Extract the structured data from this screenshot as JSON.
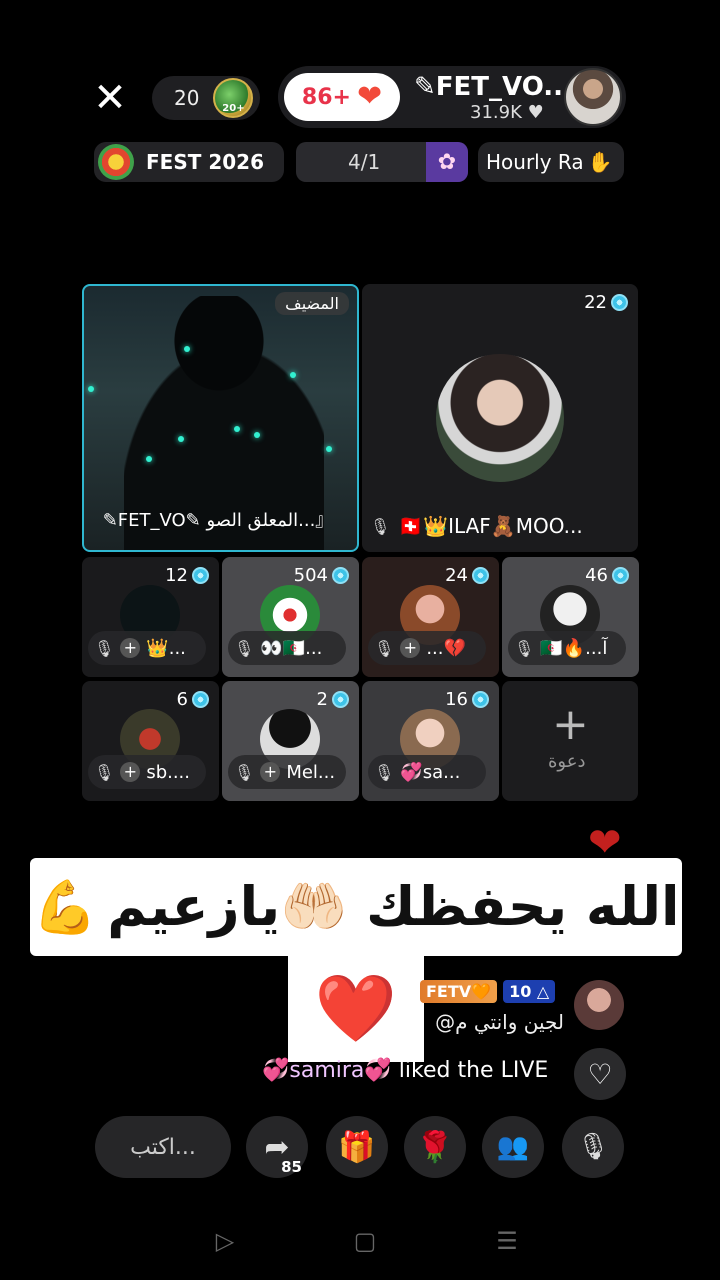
{
  "top_bar": {
    "close_icon": "close-icon",
    "viewer_count": "20",
    "level_badge_label": "20+",
    "likes_count": "86+",
    "host_name": "✎FET_VO...",
    "host_followers": "31.9K"
  },
  "event_row": {
    "fest_label": "FEST 2026",
    "rank_label": "4/1",
    "hourly_label": "Hourly Ra"
  },
  "host_tile": {
    "tag": "المضيف",
    "name": "✎FET_VO✎  المعلق الصو...』"
  },
  "guests": [
    {
      "score": "22",
      "name": "🇨🇭👑ILAF🧸MOO..."
    },
    {
      "score": "12",
      "name": "👑..."
    },
    {
      "score": "504",
      "name": "👀🇩🇿..."
    },
    {
      "score": "24",
      "name": "...💔"
    },
    {
      "score": "46",
      "name": "🇩🇿🔥...آ"
    },
    {
      "score": "6",
      "name": "sb...."
    },
    {
      "score": "2",
      "name": "Mel..."
    },
    {
      "score": "16",
      "name": "💞sa..."
    }
  ],
  "invite_label": "دعوة",
  "caption": {
    "text": "الله يحفظك 🤲🏻يازعيم",
    "emoji": "💪"
  },
  "heart_emoji": "❤️",
  "chat": {
    "fan_badge": "FETV🧡",
    "level_badge": "10 △",
    "message": "@لجين وانتي م",
    "liked_user": "💞samira💞",
    "liked_text": " liked the LIVE"
  },
  "toolbar": {
    "comment_placeholder": "اكتب...",
    "share_count": "85"
  },
  "colors": {
    "host_border": "#2fb7d0",
    "like_red": "#e8334a",
    "background": "#000000"
  }
}
